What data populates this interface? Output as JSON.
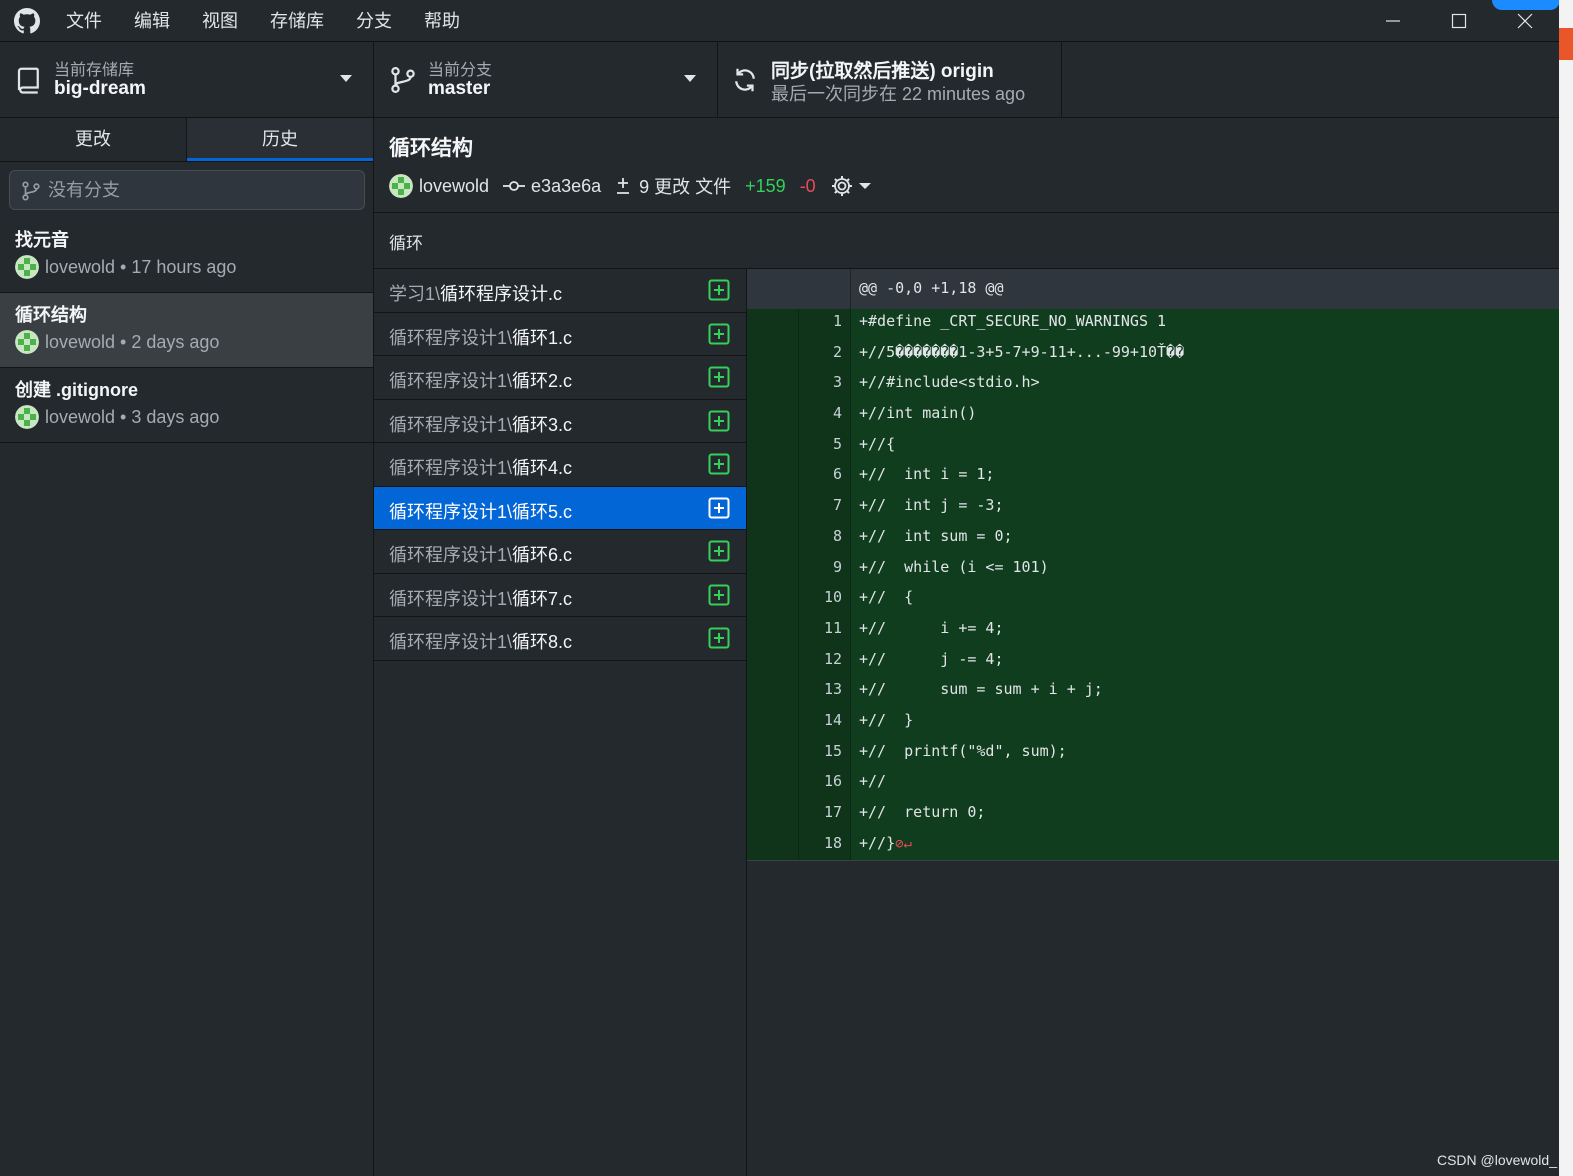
{
  "window": {
    "menu": [
      "文件",
      "编辑",
      "视图",
      "存储库",
      "分支",
      "帮助"
    ]
  },
  "toolbar": {
    "repository": {
      "label": "当前存储库",
      "value": "big-dream"
    },
    "branch": {
      "label": "当前分支",
      "value": "master"
    },
    "sync": {
      "title": "同步(拉取然后推送) origin",
      "subtitle": "最后一次同步在 22 minutes ago"
    }
  },
  "sidebar": {
    "tabs": [
      {
        "label": "更改",
        "active": false
      },
      {
        "label": "历史",
        "active": true
      }
    ],
    "branch_filter_placeholder": "没有分支",
    "commits": [
      {
        "title": "找元音",
        "author": "lovewold",
        "time": "17 hours ago",
        "selected": false
      },
      {
        "title": "循环结构",
        "author": "lovewold",
        "time": "2 days ago",
        "selected": true
      },
      {
        "title": "创建 .gitignore",
        "author": "lovewold",
        "time": "3 days ago",
        "selected": false
      }
    ]
  },
  "commit": {
    "summary": "循环结构",
    "author": "lovewold",
    "sha": "e3a3e6a",
    "files_changed": "9 更改 文件",
    "additions": "+159",
    "deletions": "-0",
    "description": "循环"
  },
  "files": [
    {
      "dir": "学习1\\",
      "name": "循环程序设计.c",
      "status": "added",
      "selected": false
    },
    {
      "dir": "循环程序设计1\\",
      "name": "循环1.c",
      "status": "added",
      "selected": false
    },
    {
      "dir": "循环程序设计1\\",
      "name": "循环2.c",
      "status": "added",
      "selected": false
    },
    {
      "dir": "循环程序设计1\\",
      "name": "循环3.c",
      "status": "added",
      "selected": false
    },
    {
      "dir": "循环程序设计1\\",
      "name": "循环4.c",
      "status": "added",
      "selected": false
    },
    {
      "dir": "循环程序设计1\\",
      "name": "循环5.c",
      "status": "added",
      "selected": true
    },
    {
      "dir": "循环程序设计1\\",
      "name": "循环6.c",
      "status": "added",
      "selected": false
    },
    {
      "dir": "循环程序设计1\\",
      "name": "循环7.c",
      "status": "added",
      "selected": false
    },
    {
      "dir": "循环程序设计1\\",
      "name": "循环8.c",
      "status": "added",
      "selected": false
    }
  ],
  "diff": {
    "hunk_header": "@@ -0,0 +1,18 @@",
    "lines": [
      {
        "n": "1",
        "code": "+#define _CRT_SECURE_NO_WARNINGS 1"
      },
      {
        "n": "2",
        "code": "+//5�������1-3+5-7+9-11+...-99+10Ť��"
      },
      {
        "n": "3",
        "code": "+//#include<stdio.h>"
      },
      {
        "n": "4",
        "code": "+//int main()"
      },
      {
        "n": "5",
        "code": "+//{"
      },
      {
        "n": "6",
        "code": "+//  int i = 1;"
      },
      {
        "n": "7",
        "code": "+//  int j = -3;"
      },
      {
        "n": "8",
        "code": "+//  int sum = 0;"
      },
      {
        "n": "9",
        "code": "+//  while (i <= 101)"
      },
      {
        "n": "10",
        "code": "+//  {"
      },
      {
        "n": "11",
        "code": "+//      i += 4;"
      },
      {
        "n": "12",
        "code": "+//      j -= 4;"
      },
      {
        "n": "13",
        "code": "+//      sum = sum + i + j;"
      },
      {
        "n": "14",
        "code": "+//  }"
      },
      {
        "n": "15",
        "code": "+//  printf(\"%d\", sum);"
      },
      {
        "n": "16",
        "code": "+//"
      },
      {
        "n": "17",
        "code": "+//  return 0;"
      },
      {
        "n": "18",
        "code": "+//}"
      }
    ],
    "eol_marker": "⊘↵"
  },
  "watermark": "CSDN @lovewold_"
}
